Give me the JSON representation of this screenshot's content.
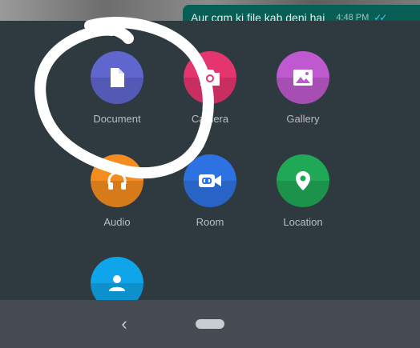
{
  "chat": {
    "message_text": "Aur cgm ki file kab deni hai",
    "message_time": "4:48 PM",
    "read_ticks": "✓✓"
  },
  "attach_menu": {
    "items": [
      {
        "label": "Document",
        "icon": "document-icon",
        "color": "#5f66cd"
      },
      {
        "label": "Camera",
        "icon": "camera-icon",
        "color": "#e5356f"
      },
      {
        "label": "Gallery",
        "icon": "gallery-icon",
        "color": "#bf59cf"
      },
      {
        "label": "Audio",
        "icon": "headphones-icon",
        "color": "#f58d1e"
      },
      {
        "label": "Room",
        "icon": "video-link-icon",
        "color": "#2d72e2"
      },
      {
        "label": "Location",
        "icon": "location-pin-icon",
        "color": "#1fa855"
      },
      {
        "label": "",
        "icon": "contact-icon",
        "color": "#0ea5ea"
      }
    ]
  },
  "navbar": {
    "back_icon": "chevron-left-icon",
    "home_icon": "home-pill-icon"
  },
  "annotation": {
    "scribble": "white freehand circle around Document",
    "color": "#ffffff"
  }
}
